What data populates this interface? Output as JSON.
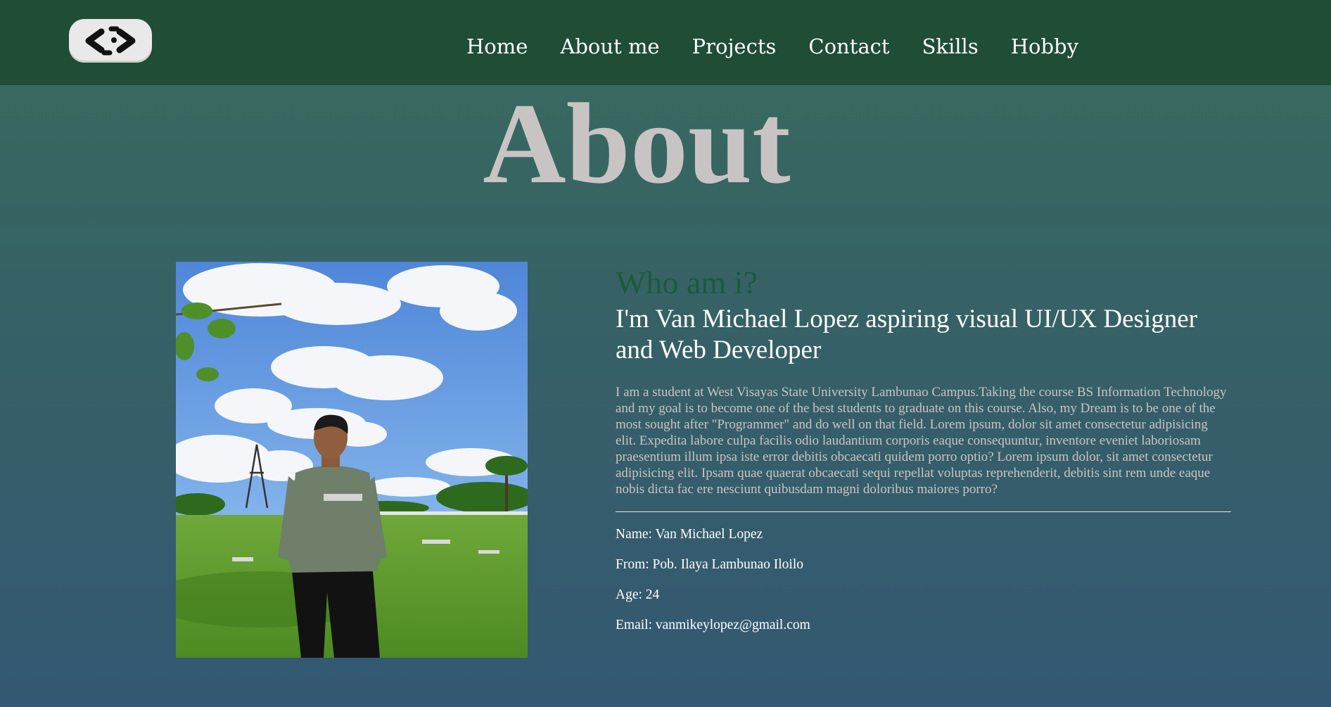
{
  "nav": {
    "logo_icon": "code-chevrons-logo",
    "items": [
      "Home",
      "About me",
      "Projects",
      "Contact",
      "Skills",
      "Hobby"
    ]
  },
  "page_title": "About",
  "photo": {
    "icon": "portrait-photo"
  },
  "about": {
    "heading": "Who am i?",
    "intro": "I'm Van Michael Lopez aspiring visual UI/UX Designer and Web Developer",
    "description": "I am a student at West Visayas State University Lambunao Campus.Taking the course BS Information Technology and my goal is to become one of the best students to graduate on this course. Also, my Dream is to be one of the most sought after \"Programmer\" and do well on that field. Lorem ipsum, dolor sit amet consectetur adipisicing elit. Expedita labore culpa facilis odio laudantium corporis eaque consequuntur, inventore eveniet laboriosam praesentium illum ipsa iste error debitis obcaecati quidem porro optio? Lorem ipsum dolor, sit amet consectetur adipisicing elit. Ipsam quae quaerat obcaecati sequi repellat voluptas reprehenderit, debitis sint rem unde eaque nobis dicta fac ere nesciunt quibusdam magni doloribus maiores porro?",
    "details": {
      "name": "Name: Van Michael Lopez",
      "from": "From: Pob. Ilaya Lambunao Iloilo",
      "age": "Age: 24",
      "email": "Email: vanmikeylopez@gmail.com"
    }
  },
  "colors": {
    "navbar": "#1f4d36",
    "title": "#c9c4c4",
    "heading": "#1c5a3a",
    "text": "#ffffff"
  }
}
